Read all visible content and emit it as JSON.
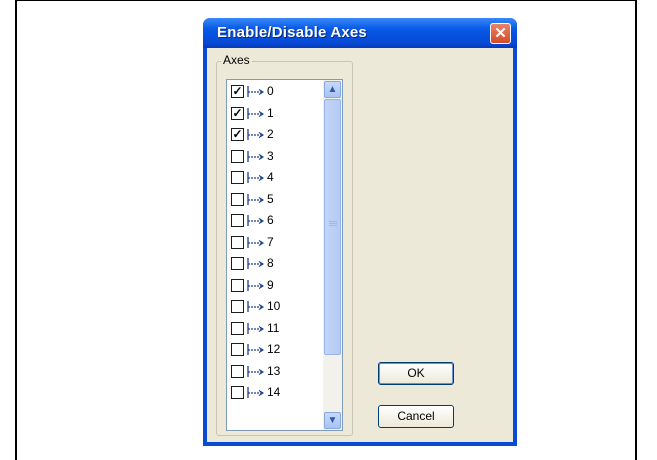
{
  "dialog": {
    "title": "Enable/Disable Axes",
    "group_label": "Axes",
    "axes": [
      {
        "label": "0",
        "checked": true
      },
      {
        "label": "1",
        "checked": true
      },
      {
        "label": "2",
        "checked": true
      },
      {
        "label": "3",
        "checked": false
      },
      {
        "label": "4",
        "checked": false
      },
      {
        "label": "5",
        "checked": false
      },
      {
        "label": "6",
        "checked": false
      },
      {
        "label": "7",
        "checked": false
      },
      {
        "label": "8",
        "checked": false
      },
      {
        "label": "9",
        "checked": false
      },
      {
        "label": "10",
        "checked": false
      },
      {
        "label": "11",
        "checked": false
      },
      {
        "label": "12",
        "checked": false
      },
      {
        "label": "13",
        "checked": false
      },
      {
        "label": "14",
        "checked": false
      }
    ],
    "ok_label": "OK",
    "cancel_label": "Cancel",
    "icons": {
      "close": "close-icon",
      "axis": "axis-icon",
      "scroll_up": "scroll-up-icon",
      "scroll_down": "scroll-down-icon"
    }
  }
}
